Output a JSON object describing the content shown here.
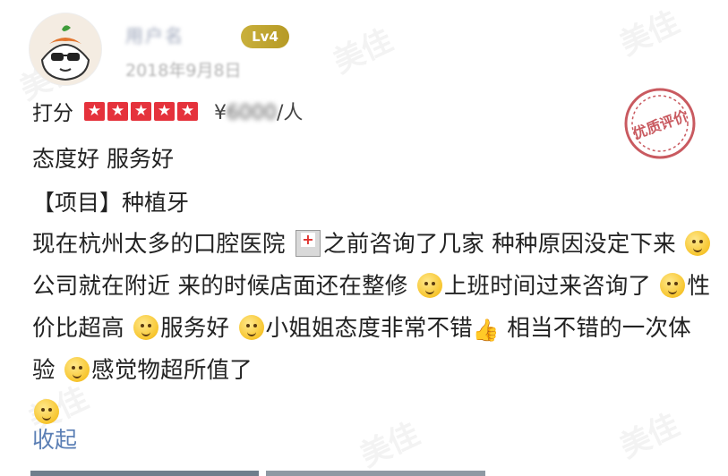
{
  "user": {
    "name": "用户名",
    "level": "Lv4",
    "date": "2018年9月8日"
  },
  "rating": {
    "label": "打分",
    "stars": 5,
    "price_prefix": "¥",
    "price_value": "6000",
    "price_suffix": "/人"
  },
  "stamp": {
    "text": "优质评价"
  },
  "tags": "态度好 服务好",
  "project": "【项目】种植牙",
  "review": {
    "seg1": "现在杭州太多的口腔医院",
    "seg2": "之前咨询了几家 种种原因没定下来",
    "seg3": "公司就在附近 来的时候店面还在整修",
    "seg4": "上班时间过来咨询了",
    "seg5": "性价比超高",
    "seg6": "服务好",
    "seg7": "小姐姐态度非常不错",
    "seg8": "相当不错的一次体验",
    "seg9": "感觉物超所值了"
  },
  "collapse": "收起",
  "watermark": "美佳",
  "colors": {
    "star_red": "#e5323c",
    "level_gold": "#c9b03c",
    "link_blue": "#5b7fb5",
    "stamp_red": "#c95a60"
  }
}
